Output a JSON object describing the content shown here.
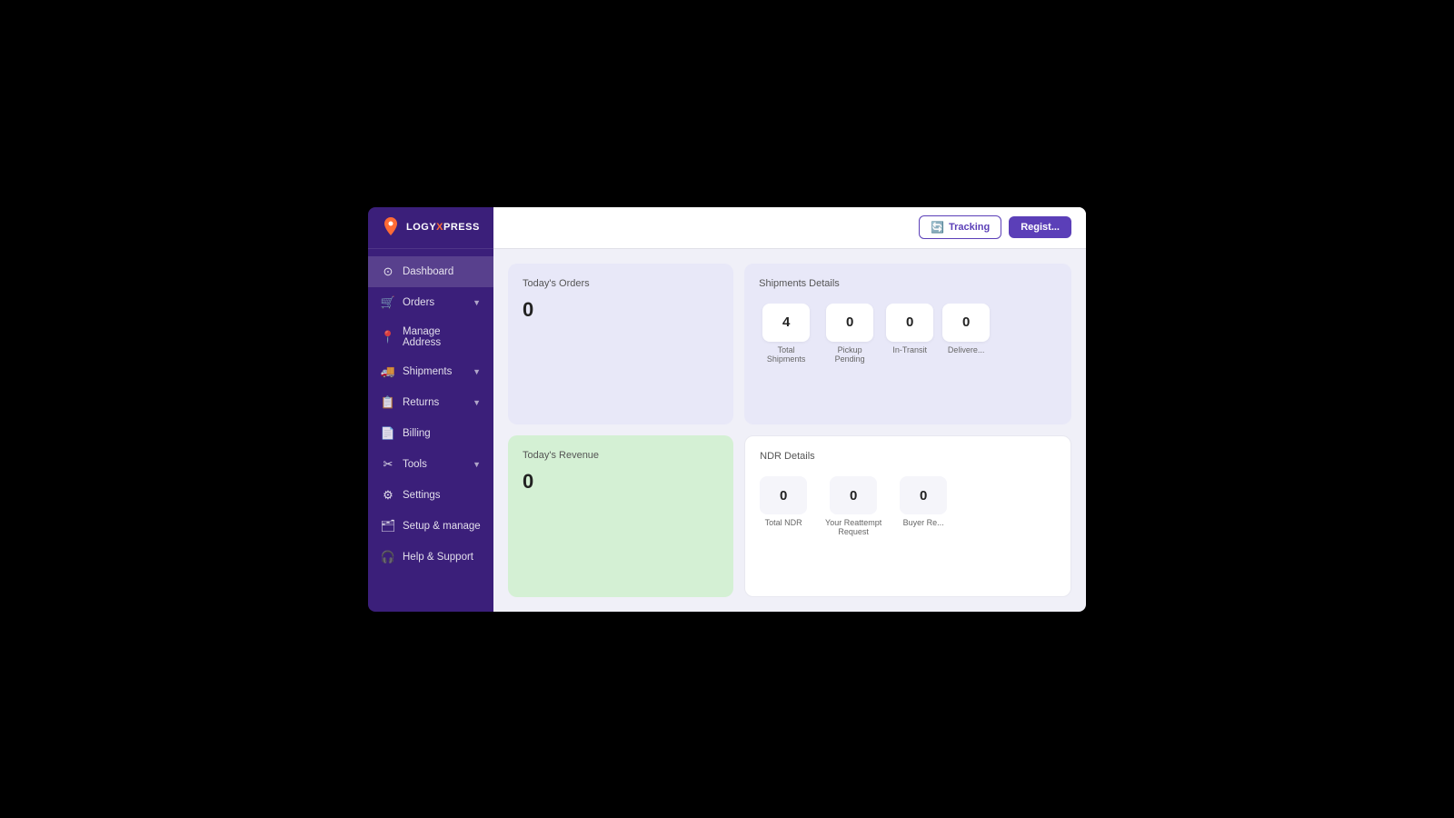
{
  "logo": {
    "text_before": "LOGY",
    "text_x": "X",
    "text_after": "PRESS"
  },
  "sidebar": {
    "items": [
      {
        "id": "dashboard",
        "label": "Dashboard",
        "icon": "⊙",
        "active": true
      },
      {
        "id": "orders",
        "label": "Orders",
        "icon": "🛒",
        "has_chevron": true
      },
      {
        "id": "manage-address",
        "label": "Manage Address",
        "icon": "📍"
      },
      {
        "id": "shipments",
        "label": "Shipments",
        "icon": "🚚",
        "has_chevron": true
      },
      {
        "id": "returns",
        "label": "Returns",
        "icon": "📋",
        "has_chevron": true
      },
      {
        "id": "billing",
        "label": "Billing",
        "icon": "📄"
      },
      {
        "id": "tools",
        "label": "Tools",
        "icon": "✂",
        "has_chevron": true
      },
      {
        "id": "settings",
        "label": "Settings",
        "icon": "⚙"
      },
      {
        "id": "setup-manage",
        "label": "Setup & manage",
        "icon": "🗂"
      },
      {
        "id": "help-support",
        "label": "Help & Support",
        "icon": "🎧"
      }
    ]
  },
  "topbar": {
    "tracking_label": "Tracking",
    "register_label": "Regist..."
  },
  "dashboard": {
    "orders_card": {
      "title": "Today's Orders",
      "value": "0"
    },
    "revenue_card": {
      "title": "Today's Revenue",
      "value": "0"
    },
    "shipments_card": {
      "title": "Shipments Details",
      "stats": [
        {
          "value": "4",
          "label": "Total Shipments"
        },
        {
          "value": "0",
          "label": "Pickup Pending"
        },
        {
          "value": "0",
          "label": "In-Transit"
        },
        {
          "value": "0",
          "label": "Delivere..."
        }
      ]
    },
    "ndr_card": {
      "title": "NDR Details",
      "stats": [
        {
          "value": "0",
          "label": "Total NDR"
        },
        {
          "value": "0",
          "label": "Your Reattempt Request"
        },
        {
          "value": "0",
          "label": "Buyer Re..."
        }
      ]
    }
  }
}
